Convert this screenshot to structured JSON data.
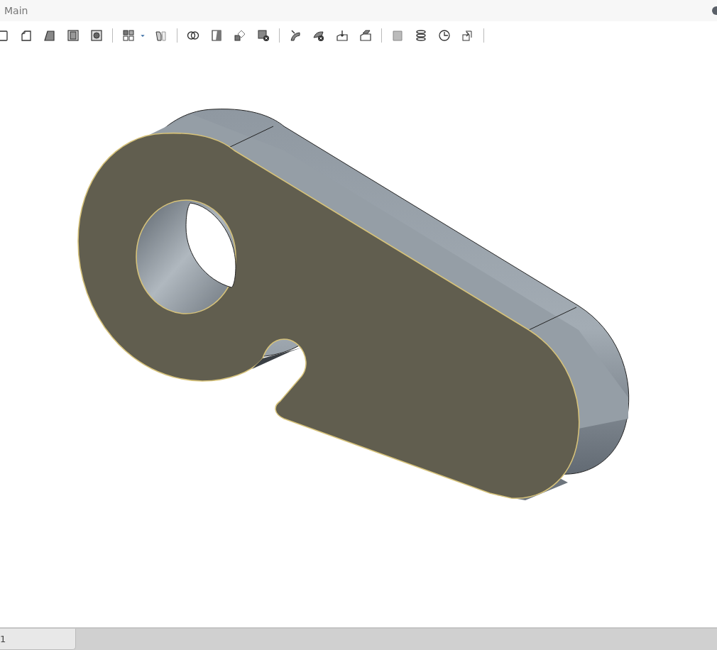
{
  "window": {
    "title": "Main"
  },
  "toolbar": {
    "groups": [
      [
        {
          "kind": "box"
        },
        {
          "kind": "chamfer"
        },
        {
          "kind": "taper"
        },
        {
          "kind": "shell"
        },
        {
          "kind": "hole"
        }
      ],
      [
        {
          "kind": "grid"
        },
        {
          "kind": "dropdown"
        },
        {
          "kind": "mirror"
        }
      ],
      [
        {
          "kind": "intersect"
        },
        {
          "kind": "split"
        },
        {
          "kind": "transform"
        },
        {
          "kind": "remove"
        }
      ],
      [
        {
          "kind": "sweep"
        },
        {
          "kind": "sweep-remove"
        },
        {
          "kind": "extrude"
        },
        {
          "kind": "lift"
        }
      ],
      [
        {
          "kind": "plane"
        },
        {
          "kind": "helix"
        },
        {
          "kind": "revolve"
        },
        {
          "kind": "push"
        }
      ]
    ]
  },
  "tabs": [
    {
      "label": "1",
      "selected": true
    }
  ]
}
